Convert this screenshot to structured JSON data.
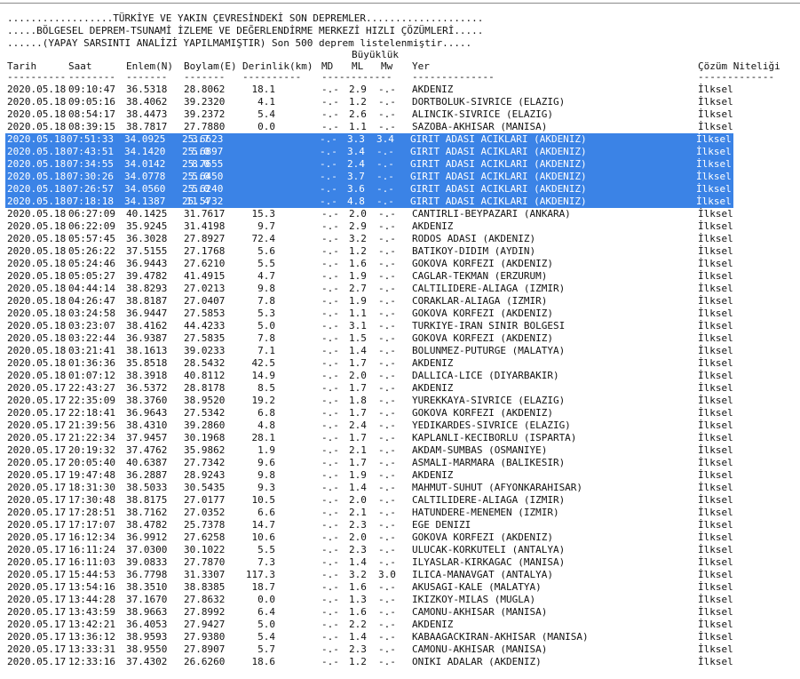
{
  "header": {
    "line1": "..................TÜRKİYE VE YAKIN ÇEVRESİNDEKİ SON DEPREMLER....................",
    "line2": ".....BÖLGESEL DEPREM-TSUNAMİ İZLEME VE DEĞERLENDİRME MERKEZİ HIZLI ÇÖZÜMLERİ.....",
    "line3": "......(YAPAY SARSINTI ANALİZİ YAPILMAMIŞTIR) Son 500 deprem listelenmiştir.....",
    "buyukluk": "Büyüklük"
  },
  "columns": {
    "tarih": "Tarih",
    "saat": "Saat",
    "enlem": "Enlem(N)",
    "boylam": "Boylam(E)",
    "derinlik": "Derinlik(km)",
    "md": "MD",
    "ml": "ML",
    "mw": "Mw",
    "yer": "Yer",
    "cozum": "Çözüm Niteliği"
  },
  "separators": {
    "tarih": "----------",
    "saat": "--------",
    "enlem": "-------",
    "boylam": "-------",
    "derinlik": "----------",
    "mag": "------------",
    "yer": "--------------",
    "cozum": "-------------"
  },
  "rows": [
    {
      "tarih": "2020.05.18",
      "saat": "09:10:47",
      "enlem": "36.5318",
      "boylam": "28.8062",
      "derinlik": "18.1",
      "md": "-.-",
      "ml": "2.9",
      "mw": "-.-",
      "yer": "AKDENIZ",
      "cozum": "İlksel",
      "selected": false
    },
    {
      "tarih": "2020.05.18",
      "saat": "09:05:16",
      "enlem": "38.4062",
      "boylam": "39.2320",
      "derinlik": "4.1",
      "md": "-.-",
      "ml": "1.2",
      "mw": "-.-",
      "yer": "DORTBOLUK-SIVRICE (ELAZIG)",
      "cozum": "İlksel",
      "selected": false
    },
    {
      "tarih": "2020.05.18",
      "saat": "08:54:17",
      "enlem": "38.4473",
      "boylam": "39.2372",
      "derinlik": "5.4",
      "md": "-.-",
      "ml": "2.6",
      "mw": "-.-",
      "yer": "ALINCIK-SIVRICE (ELAZIG)",
      "cozum": "İlksel",
      "selected": false
    },
    {
      "tarih": "2020.05.18",
      "saat": "08:39:15",
      "enlem": "38.7817",
      "boylam": "27.7880",
      "derinlik": "0.0",
      "md": "-.-",
      "ml": "1.1",
      "mw": "-.-",
      "yer": "SAZOBA-AKHISAR (MANISA)",
      "cozum": "İlksel",
      "selected": false
    },
    {
      "tarih": "2020.05.18",
      "saat": "07:51:33",
      "enlem": "34.0925",
      "boylam": "25.6623",
      "derinlik": "3.7",
      "md": "-.-",
      "ml": "3.3",
      "mw": "3.4",
      "yer": "GIRIT ADASI ACIKLARI (AKDENIZ)",
      "cozum": "İlksel",
      "selected": true
    },
    {
      "tarih": "2020.05.18",
      "saat": "07:43:51",
      "enlem": "34.1420",
      "boylam": "25.6897",
      "derinlik": "5.0",
      "md": "-.-",
      "ml": "3.4",
      "mw": "-.-",
      "yer": "GIRIT ADASI ACIKLARI (AKDENIZ)",
      "cozum": "İlksel",
      "selected": true
    },
    {
      "tarih": "2020.05.18",
      "saat": "07:34:55",
      "enlem": "34.0142",
      "boylam": "25.7655",
      "derinlik": "8.0",
      "md": "-.-",
      "ml": "2.4",
      "mw": "-.-",
      "yer": "GIRIT ADASI ACIKLARI (AKDENIZ)",
      "cozum": "İlksel",
      "selected": true
    },
    {
      "tarih": "2020.05.18",
      "saat": "07:30:26",
      "enlem": "34.0778",
      "boylam": "25.6450",
      "derinlik": "5.0",
      "md": "-.-",
      "ml": "3.7",
      "mw": "-.-",
      "yer": "GIRIT ADASI ACIKLARI (AKDENIZ)",
      "cozum": "İlksel",
      "selected": true
    },
    {
      "tarih": "2020.05.18",
      "saat": "07:26:57",
      "enlem": "34.0560",
      "boylam": "25.6240",
      "derinlik": "5.0",
      "md": "-.-",
      "ml": "3.6",
      "mw": "-.-",
      "yer": "GIRIT ADASI ACIKLARI (AKDENIZ)",
      "cozum": "İlksel",
      "selected": true
    },
    {
      "tarih": "2020.05.18",
      "saat": "07:18:18",
      "enlem": "34.1387",
      "boylam": "25.5732",
      "derinlik": "11.4",
      "md": "-.-",
      "ml": "4.8",
      "mw": "-.-",
      "yer": "GIRIT ADASI ACIKLARI (AKDENIZ)",
      "cozum": "İlksel",
      "selected": true
    },
    {
      "tarih": "2020.05.18",
      "saat": "06:27:09",
      "enlem": "40.1425",
      "boylam": "31.7617",
      "derinlik": "15.3",
      "md": "-.-",
      "ml": "2.0",
      "mw": "-.-",
      "yer": "CANTIRLI-BEYPAZARI (ANKARA)",
      "cozum": "İlksel",
      "selected": false
    },
    {
      "tarih": "2020.05.18",
      "saat": "06:22:09",
      "enlem": "35.9245",
      "boylam": "31.4198",
      "derinlik": "9.7",
      "md": "-.-",
      "ml": "2.9",
      "mw": "-.-",
      "yer": "AKDENIZ",
      "cozum": "İlksel",
      "selected": false
    },
    {
      "tarih": "2020.05.18",
      "saat": "05:57:45",
      "enlem": "36.3028",
      "boylam": "27.8927",
      "derinlik": "72.4",
      "md": "-.-",
      "ml": "3.2",
      "mw": "-.-",
      "yer": "RODOS ADASI (AKDENIZ)",
      "cozum": "İlksel",
      "selected": false
    },
    {
      "tarih": "2020.05.18",
      "saat": "05:26:22",
      "enlem": "37.5155",
      "boylam": "27.1768",
      "derinlik": "5.6",
      "md": "-.-",
      "ml": "1.2",
      "mw": "-.-",
      "yer": "BATIKOY-DIDIM (AYDIN)",
      "cozum": "İlksel",
      "selected": false
    },
    {
      "tarih": "2020.05.18",
      "saat": "05:24:46",
      "enlem": "36.9443",
      "boylam": "27.6210",
      "derinlik": "5.5",
      "md": "-.-",
      "ml": "1.6",
      "mw": "-.-",
      "yer": "GOKOVA KORFEZI (AKDENIZ)",
      "cozum": "İlksel",
      "selected": false
    },
    {
      "tarih": "2020.05.18",
      "saat": "05:05:27",
      "enlem": "39.4782",
      "boylam": "41.4915",
      "derinlik": "4.7",
      "md": "-.-",
      "ml": "1.9",
      "mw": "-.-",
      "yer": "CAGLAR-TEKMAN (ERZURUM)",
      "cozum": "İlksel",
      "selected": false
    },
    {
      "tarih": "2020.05.18",
      "saat": "04:44:14",
      "enlem": "38.8293",
      "boylam": "27.0213",
      "derinlik": "9.8",
      "md": "-.-",
      "ml": "2.7",
      "mw": "-.-",
      "yer": "CALTILIDERE-ALIAGA (IZMIR)",
      "cozum": "İlksel",
      "selected": false
    },
    {
      "tarih": "2020.05.18",
      "saat": "04:26:47",
      "enlem": "38.8187",
      "boylam": "27.0407",
      "derinlik": "7.8",
      "md": "-.-",
      "ml": "1.9",
      "mw": "-.-",
      "yer": "CORAKLAR-ALIAGA (IZMIR)",
      "cozum": "İlksel",
      "selected": false
    },
    {
      "tarih": "2020.05.18",
      "saat": "03:24:58",
      "enlem": "36.9447",
      "boylam": "27.5853",
      "derinlik": "5.3",
      "md": "-.-",
      "ml": "1.1",
      "mw": "-.-",
      "yer": "GOKOVA KORFEZI (AKDENIZ)",
      "cozum": "İlksel",
      "selected": false
    },
    {
      "tarih": "2020.05.18",
      "saat": "03:23:07",
      "enlem": "38.4162",
      "boylam": "44.4233",
      "derinlik": "5.0",
      "md": "-.-",
      "ml": "3.1",
      "mw": "-.-",
      "yer": "TURKIYE-IRAN SINIR BOLGESI",
      "cozum": "İlksel",
      "selected": false
    },
    {
      "tarih": "2020.05.18",
      "saat": "03:22:44",
      "enlem": "36.9387",
      "boylam": "27.5835",
      "derinlik": "7.8",
      "md": "-.-",
      "ml": "1.5",
      "mw": "-.-",
      "yer": "GOKOVA KORFEZI (AKDENIZ)",
      "cozum": "İlksel",
      "selected": false
    },
    {
      "tarih": "2020.05.18",
      "saat": "03:21:41",
      "enlem": "38.1613",
      "boylam": "39.0233",
      "derinlik": "7.1",
      "md": "-.-",
      "ml": "1.4",
      "mw": "-.-",
      "yer": "BOLUNMEZ-PUTURGE (MALATYA)",
      "cozum": "İlksel",
      "selected": false
    },
    {
      "tarih": "2020.05.18",
      "saat": "01:36:36",
      "enlem": "35.8518",
      "boylam": "28.5432",
      "derinlik": "42.5",
      "md": "-.-",
      "ml": "1.7",
      "mw": "-.-",
      "yer": "AKDENIZ",
      "cozum": "İlksel",
      "selected": false
    },
    {
      "tarih": "2020.05.18",
      "saat": "01:07:12",
      "enlem": "38.3918",
      "boylam": "40.8112",
      "derinlik": "14.9",
      "md": "-.-",
      "ml": "2.0",
      "mw": "-.-",
      "yer": "DALLICA-LICE (DIYARBAKIR)",
      "cozum": "İlksel",
      "selected": false
    },
    {
      "tarih": "2020.05.17",
      "saat": "22:43:27",
      "enlem": "36.5372",
      "boylam": "28.8178",
      "derinlik": "8.5",
      "md": "-.-",
      "ml": "1.7",
      "mw": "-.-",
      "yer": "AKDENIZ",
      "cozum": "İlksel",
      "selected": false
    },
    {
      "tarih": "2020.05.17",
      "saat": "22:35:09",
      "enlem": "38.3760",
      "boylam": "38.9520",
      "derinlik": "19.2",
      "md": "-.-",
      "ml": "1.8",
      "mw": "-.-",
      "yer": "YUREKKAYA-SIVRICE (ELAZIG)",
      "cozum": "İlksel",
      "selected": false
    },
    {
      "tarih": "2020.05.17",
      "saat": "22:18:41",
      "enlem": "36.9643",
      "boylam": "27.5342",
      "derinlik": "6.8",
      "md": "-.-",
      "ml": "1.7",
      "mw": "-.-",
      "yer": "GOKOVA KORFEZI (AKDENIZ)",
      "cozum": "İlksel",
      "selected": false
    },
    {
      "tarih": "2020.05.17",
      "saat": "21:39:56",
      "enlem": "38.4310",
      "boylam": "39.2860",
      "derinlik": "4.8",
      "md": "-.-",
      "ml": "2.4",
      "mw": "-.-",
      "yer": "YEDIKARDES-SIVRICE (ELAZIG)",
      "cozum": "İlksel",
      "selected": false
    },
    {
      "tarih": "2020.05.17",
      "saat": "21:22:34",
      "enlem": "37.9457",
      "boylam": "30.1968",
      "derinlik": "28.1",
      "md": "-.-",
      "ml": "1.7",
      "mw": "-.-",
      "yer": "KAPLANLI-KECIBORLU (ISPARTA)",
      "cozum": "İlksel",
      "selected": false
    },
    {
      "tarih": "2020.05.17",
      "saat": "20:19:32",
      "enlem": "37.4762",
      "boylam": "35.9862",
      "derinlik": "1.9",
      "md": "-.-",
      "ml": "2.1",
      "mw": "-.-",
      "yer": "AKDAM-SUMBAS (OSMANIYE)",
      "cozum": "İlksel",
      "selected": false
    },
    {
      "tarih": "2020.05.17",
      "saat": "20:05:40",
      "enlem": "40.6387",
      "boylam": "27.7342",
      "derinlik": "9.6",
      "md": "-.-",
      "ml": "1.7",
      "mw": "-.-",
      "yer": "ASMALI-MARMARA (BALIKESIR)",
      "cozum": "İlksel",
      "selected": false
    },
    {
      "tarih": "2020.05.17",
      "saat": "19:47:48",
      "enlem": "36.2887",
      "boylam": "28.9243",
      "derinlik": "9.8",
      "md": "-.-",
      "ml": "1.9",
      "mw": "-.-",
      "yer": "AKDENIZ",
      "cozum": "İlksel",
      "selected": false
    },
    {
      "tarih": "2020.05.17",
      "saat": "18:31:30",
      "enlem": "38.5033",
      "boylam": "30.5435",
      "derinlik": "9.3",
      "md": "-.-",
      "ml": "1.4",
      "mw": "-.-",
      "yer": "MAHMUT-SUHUT (AFYONKARAHISAR)",
      "cozum": "İlksel",
      "selected": false
    },
    {
      "tarih": "2020.05.17",
      "saat": "17:30:48",
      "enlem": "38.8175",
      "boylam": "27.0177",
      "derinlik": "10.5",
      "md": "-.-",
      "ml": "2.0",
      "mw": "-.-",
      "yer": "CALTILIDERE-ALIAGA (IZMIR)",
      "cozum": "İlksel",
      "selected": false
    },
    {
      "tarih": "2020.05.17",
      "saat": "17:28:51",
      "enlem": "38.7162",
      "boylam": "27.0352",
      "derinlik": "6.6",
      "md": "-.-",
      "ml": "2.1",
      "mw": "-.-",
      "yer": "HATUNDERE-MENEMEN (IZMIR)",
      "cozum": "İlksel",
      "selected": false
    },
    {
      "tarih": "2020.05.17",
      "saat": "17:17:07",
      "enlem": "38.4782",
      "boylam": "25.7378",
      "derinlik": "14.7",
      "md": "-.-",
      "ml": "2.3",
      "mw": "-.-",
      "yer": "EGE DENIZI",
      "cozum": "İlksel",
      "selected": false
    },
    {
      "tarih": "2020.05.17",
      "saat": "16:12:34",
      "enlem": "36.9912",
      "boylam": "27.6258",
      "derinlik": "10.6",
      "md": "-.-",
      "ml": "2.0",
      "mw": "-.-",
      "yer": "GOKOVA KORFEZI (AKDENIZ)",
      "cozum": "İlksel",
      "selected": false
    },
    {
      "tarih": "2020.05.17",
      "saat": "16:11:24",
      "enlem": "37.0300",
      "boylam": "30.1022",
      "derinlik": "5.5",
      "md": "-.-",
      "ml": "2.3",
      "mw": "-.-",
      "yer": "ULUCAK-KORKUTELI (ANTALYA)",
      "cozum": "İlksel",
      "selected": false
    },
    {
      "tarih": "2020.05.17",
      "saat": "16:11:03",
      "enlem": "39.0833",
      "boylam": "27.7870",
      "derinlik": "7.3",
      "md": "-.-",
      "ml": "1.4",
      "mw": "-.-",
      "yer": "ILYASLAR-KIRKAGAC (MANISA)",
      "cozum": "İlksel",
      "selected": false
    },
    {
      "tarih": "2020.05.17",
      "saat": "15:44:53",
      "enlem": "36.7798",
      "boylam": "31.3307",
      "derinlik": "117.3",
      "md": "-.-",
      "ml": "3.2",
      "mw": "3.0",
      "yer": "ILICA-MANAVGAT (ANTALYA)",
      "cozum": "İlksel",
      "selected": false
    },
    {
      "tarih": "2020.05.17",
      "saat": "13:54:16",
      "enlem": "38.3510",
      "boylam": "38.8385",
      "derinlik": "18.7",
      "md": "-.-",
      "ml": "1.6",
      "mw": "-.-",
      "yer": "AKUSAGI-KALE (MALATYA)",
      "cozum": "İlksel",
      "selected": false
    },
    {
      "tarih": "2020.05.17",
      "saat": "13:44:28",
      "enlem": "37.1670",
      "boylam": "27.8632",
      "derinlik": "0.0",
      "md": "-.-",
      "ml": "1.3",
      "mw": "-.-",
      "yer": "IKIZKOY-MILAS (MUGLA)",
      "cozum": "İlksel",
      "selected": false
    },
    {
      "tarih": "2020.05.17",
      "saat": "13:43:59",
      "enlem": "38.9663",
      "boylam": "27.8992",
      "derinlik": "6.4",
      "md": "-.-",
      "ml": "1.6",
      "mw": "-.-",
      "yer": "CAMONU-AKHISAR (MANISA)",
      "cozum": "İlksel",
      "selected": false
    },
    {
      "tarih": "2020.05.17",
      "saat": "13:42:21",
      "enlem": "36.4053",
      "boylam": "27.9427",
      "derinlik": "5.0",
      "md": "-.-",
      "ml": "2.2",
      "mw": "-.-",
      "yer": "AKDENIZ",
      "cozum": "İlksel",
      "selected": false
    },
    {
      "tarih": "2020.05.17",
      "saat": "13:36:12",
      "enlem": "38.9593",
      "boylam": "27.9380",
      "derinlik": "5.4",
      "md": "-.-",
      "ml": "1.4",
      "mw": "-.-",
      "yer": "KABAAGACKIRAN-AKHISAR (MANISA)",
      "cozum": "İlksel",
      "selected": false
    },
    {
      "tarih": "2020.05.17",
      "saat": "13:33:31",
      "enlem": "38.9550",
      "boylam": "27.8907",
      "derinlik": "5.7",
      "md": "-.-",
      "ml": "2.3",
      "mw": "-.-",
      "yer": "CAMONU-AKHISAR (MANISA)",
      "cozum": "İlksel",
      "selected": false
    },
    {
      "tarih": "2020.05.17",
      "saat": "12:33:16",
      "enlem": "37.4302",
      "boylam": "26.6260",
      "derinlik": "18.6",
      "md": "-.-",
      "ml": "1.2",
      "mw": "-.-",
      "yer": "ONIKI ADALAR (AKDENIZ)",
      "cozum": "İlksel",
      "selected": false
    }
  ]
}
